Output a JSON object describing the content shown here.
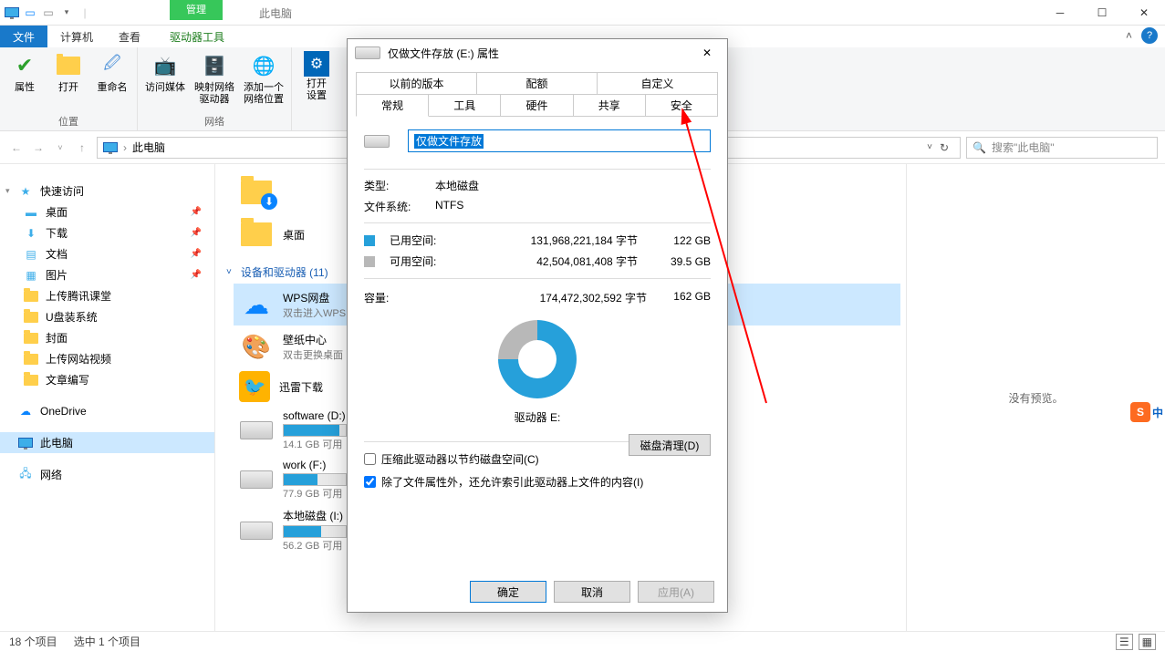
{
  "titlebar": {
    "contextual_group": "管理",
    "title": "此电脑"
  },
  "ribbon_tabs": {
    "file": "文件",
    "computer": "计算机",
    "view": "查看",
    "drive_tools": "驱动器工具"
  },
  "ribbon": {
    "properties": "属性",
    "open": "打开",
    "rename": "重命名",
    "group_location": "位置",
    "access_media": "访问媒体",
    "map_network": "映射网络\n驱动器",
    "add_network": "添加一个\n网络位置",
    "group_network": "网络",
    "open_settings": "打开\n设置"
  },
  "addressbar": {
    "this_pc": "此电脑"
  },
  "search": {
    "placeholder": "搜索\"此电脑\""
  },
  "tree": {
    "quick_access": "快速访问",
    "desktop": "桌面",
    "downloads": "下载",
    "documents": "文档",
    "pictures": "图片",
    "tencent": "上传腾讯课堂",
    "usb": "U盘装系统",
    "cover": "封面",
    "site_video": "上传网站视频",
    "article": "文章编写",
    "onedrive": "OneDrive",
    "this_pc": "此电脑",
    "network": "网络"
  },
  "content": {
    "desktop_label": "桌面",
    "section_devices": "设备和驱动器 (11)",
    "wps": {
      "title": "WPS网盘",
      "sub": "双击进入WPS"
    },
    "wallpaper": {
      "title": "壁纸中心",
      "sub": "双击更换桌面"
    },
    "xunlei": {
      "title": "迅雷下载"
    },
    "drive_d": {
      "title": "software (D:)",
      "sub": "14.1 GB 可用"
    },
    "drive_f": {
      "title": "work (F:)",
      "sub": "77.9 GB 可用"
    },
    "drive_i": {
      "title": "本地磁盘 (I:)",
      "sub": "56.2 GB 可用"
    }
  },
  "preview": {
    "none": "没有预览。"
  },
  "statusbar": {
    "items": "18 个项目",
    "selected": "选中 1 个项目"
  },
  "dialog": {
    "title": "仅做文件存放 (E:) 属性",
    "tabs_top": {
      "prev": "以前的版本",
      "quota": "配额",
      "custom": "自定义"
    },
    "tabs_bottom": {
      "general": "常规",
      "tools": "工具",
      "hardware": "硬件",
      "sharing": "共享",
      "security": "安全"
    },
    "name_value": "仅做文件存放",
    "type_label": "类型:",
    "type_value": "本地磁盘",
    "fs_label": "文件系统:",
    "fs_value": "NTFS",
    "used_label": "已用空间:",
    "used_bytes": "131,968,221,184 字节",
    "used_gb": "122 GB",
    "free_label": "可用空间:",
    "free_bytes": "42,504,081,408 字节",
    "free_gb": "39.5 GB",
    "capacity_label": "容量:",
    "capacity_bytes": "174,472,302,592 字节",
    "capacity_gb": "162 GB",
    "drive_label": "驱动器 E:",
    "cleanup": "磁盘清理(D)",
    "compress": "压缩此驱动器以节约磁盘空间(C)",
    "index": "除了文件属性外，还允许索引此驱动器上文件的内容(I)",
    "ok": "确定",
    "cancel": "取消",
    "apply": "应用(A)"
  },
  "sogou": {
    "label": "中"
  }
}
